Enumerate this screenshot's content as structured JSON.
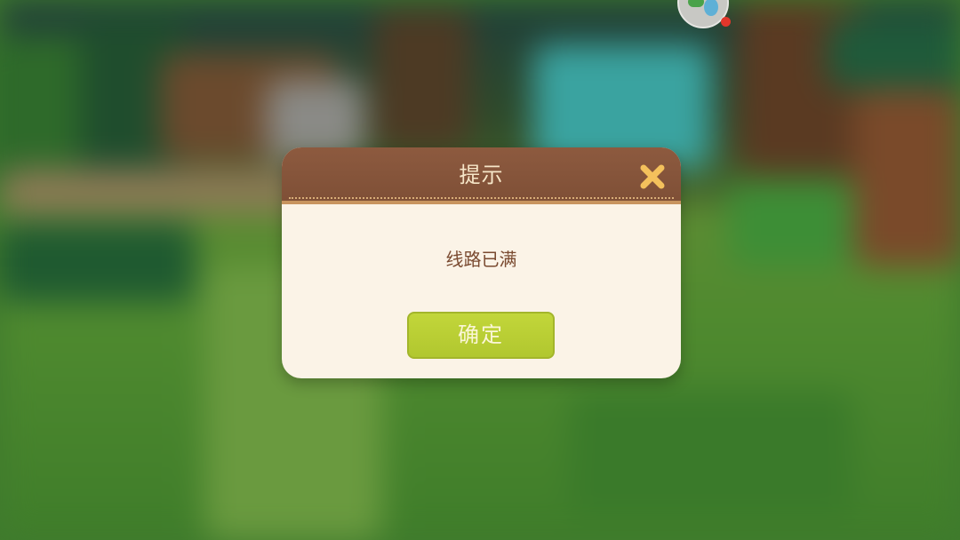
{
  "dialog": {
    "title": "提示",
    "message": "线路已满",
    "confirm_label": "确定"
  },
  "icons": {
    "close": "close-icon",
    "avatar": "avatar-icon",
    "notification": "notification-dot-icon"
  },
  "colors": {
    "header": "#7e4f36",
    "title_text": "#f6e6c8",
    "close_icon": "#f4c15c",
    "body_bg": "#fbf3e7",
    "message_text": "#7a4a30",
    "confirm_bg": "#b8cc33",
    "notify_dot": "#e2362b"
  }
}
